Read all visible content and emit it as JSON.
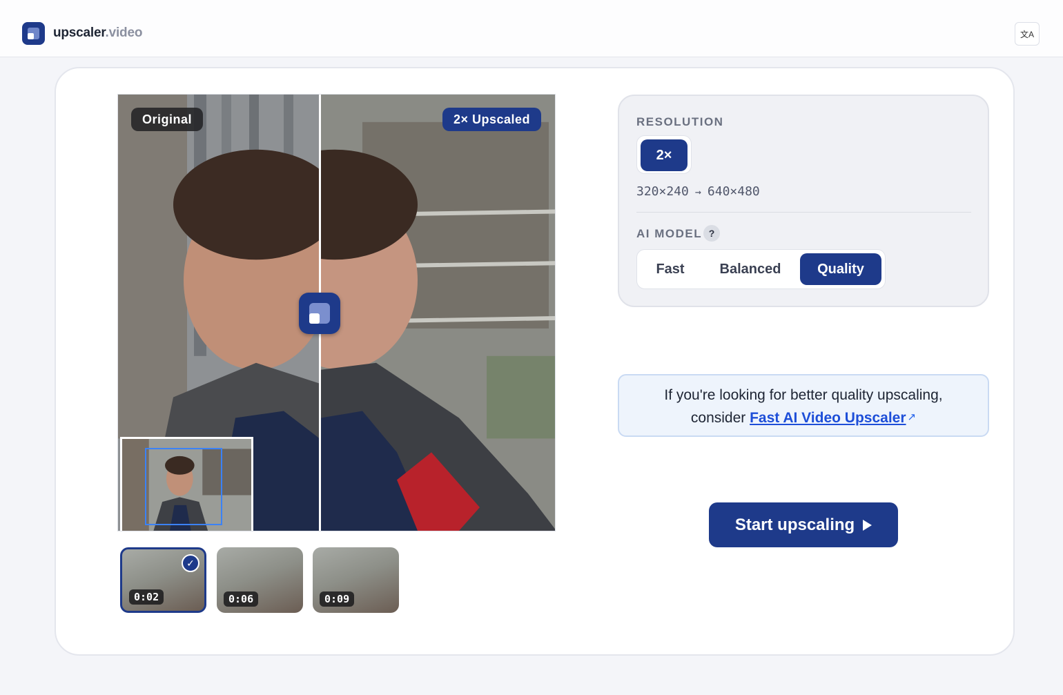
{
  "header": {
    "brand_main": "upscaler",
    "brand_tld": ".video",
    "language_icon": "translate-icon",
    "language_glyph": "文A"
  },
  "viewer": {
    "original_label": "Original",
    "upscaled_label": "2× Upscaled"
  },
  "thumbnails": [
    {
      "time": "0:02",
      "selected": true
    },
    {
      "time": "0:06",
      "selected": false
    },
    {
      "time": "0:09",
      "selected": false
    }
  ],
  "settings": {
    "resolution_label": "RESOLUTION",
    "resolution_option": "2×",
    "source_res": "320×240",
    "arrow": "→",
    "target_res": "640×480",
    "model_label": "AI MODEL",
    "help": "?",
    "models": [
      "Fast",
      "Balanced",
      "Quality"
    ],
    "selected_model": "Quality"
  },
  "info": {
    "line1": "If you're looking for better quality upscaling,",
    "line2_prefix": "consider ",
    "link_text": "Fast AI Video Upscaler",
    "ext_glyph": "↗"
  },
  "start": {
    "label": "Start upscaling"
  },
  "colors": {
    "brand": "#1e3a8a",
    "link": "#1d4ed8",
    "info_bg": "#eef4fc"
  }
}
